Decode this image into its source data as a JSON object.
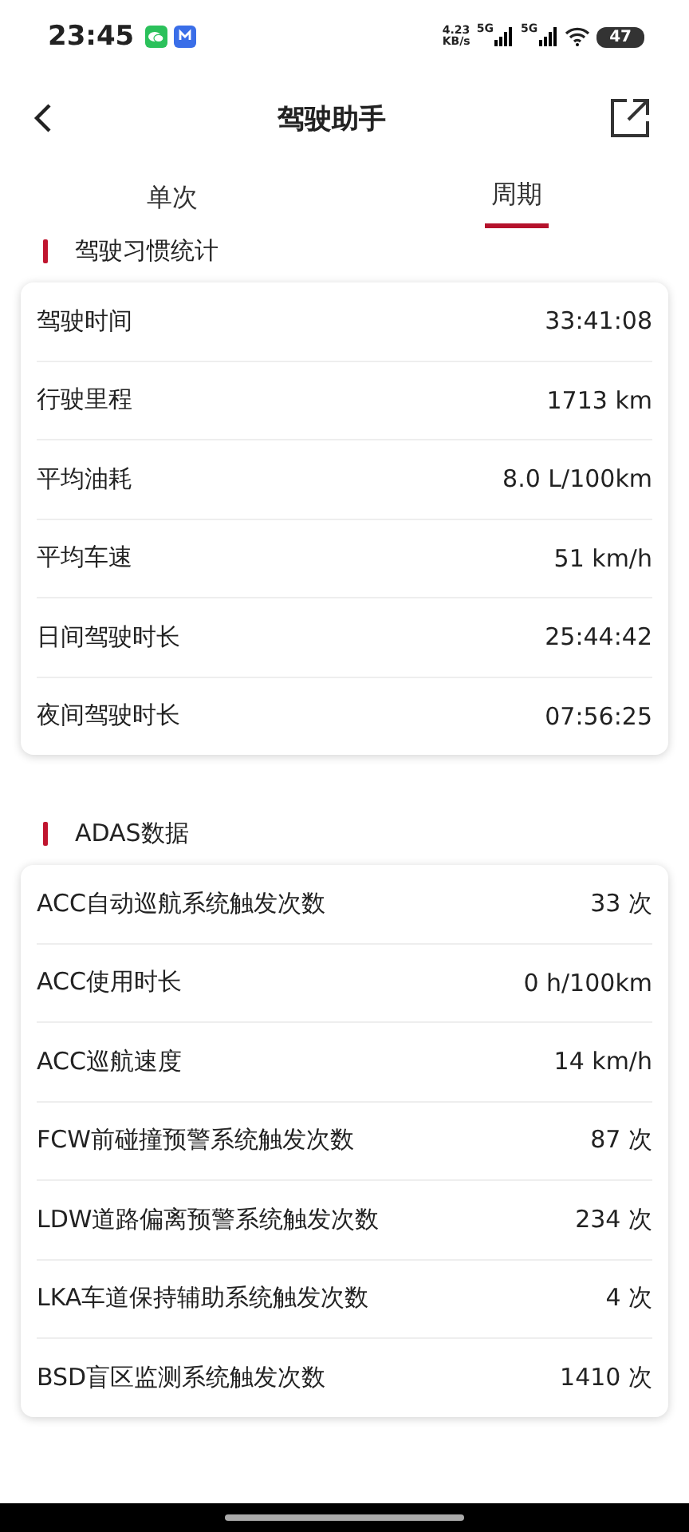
{
  "status_bar": {
    "time": "23:45",
    "speed_value": "4.23",
    "speed_unit": "KB/s",
    "network_1": "5G",
    "network_2": "5G",
    "battery": "47"
  },
  "header": {
    "title": "驾驶助手"
  },
  "tabs": [
    {
      "label": "单次",
      "selected": false
    },
    {
      "label": "周期",
      "selected": true
    }
  ],
  "sections": [
    {
      "title": "驾驶习惯统计",
      "rows": [
        {
          "label": "驾驶时间",
          "value": "33:41:08"
        },
        {
          "label": "行驶里程",
          "value": "1713 km"
        },
        {
          "label": "平均油耗",
          "value": "8.0 L/100km"
        },
        {
          "label": "平均车速",
          "value": "51 km/h"
        },
        {
          "label": "日间驾驶时长",
          "value": "25:44:42"
        },
        {
          "label": "夜间驾驶时长",
          "value": "07:56:25"
        }
      ]
    },
    {
      "title": "ADAS数据",
      "rows": [
        {
          "label": "ACC自动巡航系统触发次数",
          "value": "33 次"
        },
        {
          "label": "ACC使用时长",
          "value": "0 h/100km"
        },
        {
          "label": "ACC巡航速度",
          "value": "14 km/h"
        },
        {
          "label": "FCW前碰撞预警系统触发次数",
          "value": "87 次"
        },
        {
          "label": "LDW道路偏离预警系统触发次数",
          "value": "234 次"
        },
        {
          "label": "LKA车道保持辅助系统触发次数",
          "value": "4 次"
        },
        {
          "label": "BSD盲区监测系统触发次数",
          "value": "1410 次"
        }
      ]
    }
  ]
}
